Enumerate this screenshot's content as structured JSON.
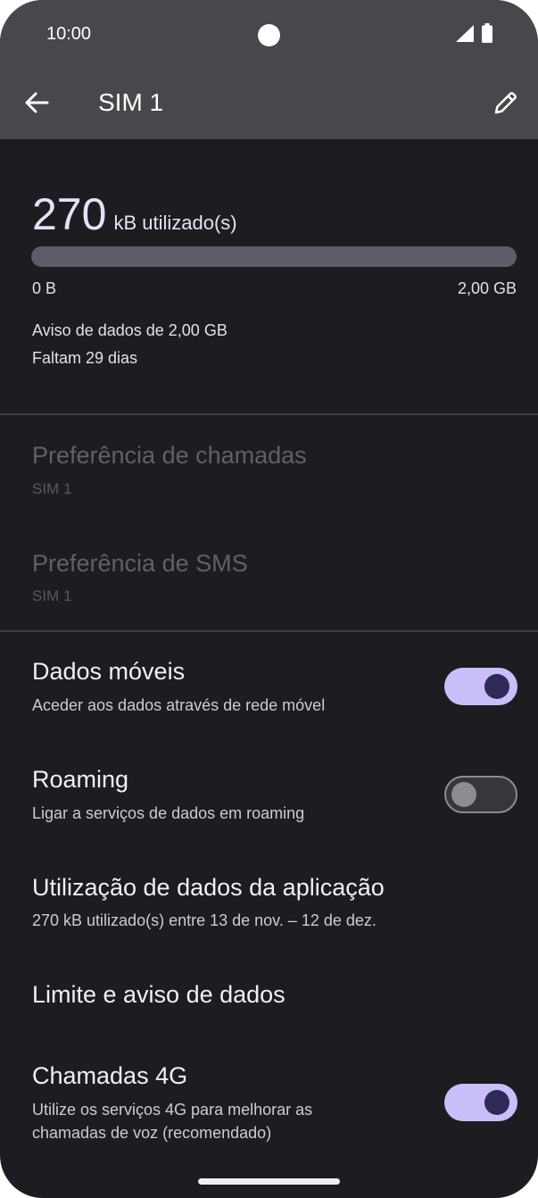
{
  "status_bar": {
    "time": "10:00",
    "icons": [
      "camera-cutout",
      "signal-icon",
      "battery-icon"
    ]
  },
  "app_bar": {
    "back_icon": "arrow-left",
    "title": "SIM 1",
    "edit_icon": "pencil"
  },
  "usage": {
    "amount": "270",
    "unit": "kB utilizado(s)",
    "progress_fraction": 0.0,
    "range_min": "0 B",
    "range_max": "2,00 GB",
    "warning": "Aviso de dados de 2,00 GB",
    "days_left": "Faltam 29 dias"
  },
  "preferences": [
    {
      "title": "Preferência de chamadas",
      "value": "SIM 1",
      "enabled": false
    },
    {
      "title": "Preferência de SMS",
      "value": "SIM 1",
      "enabled": false
    }
  ],
  "settings": {
    "mobile_data": {
      "title": "Dados móveis",
      "summary": "Aceder aos dados através de rede móvel",
      "checked": true
    },
    "roaming": {
      "title": "Roaming",
      "summary": "Ligar a serviços de dados em roaming",
      "checked": false
    },
    "app_data_usage": {
      "title": "Utilização de dados da aplicação",
      "summary": "270 kB utilizado(s) entre 13 de nov. – 12 de dez."
    },
    "data_limit": {
      "title": "Limite e aviso de dados"
    },
    "calls_4g": {
      "title": "Chamadas 4G",
      "summary_line1": "Utilize os serviços 4G para melhorar as",
      "summary_line2": "chamadas de voz (recomendado)",
      "checked": true
    }
  },
  "colors": {
    "app_bar_bg": "#48474c",
    "screen_bg": "#1d1c21",
    "toggle_on_track": "#c9bef7",
    "toggle_on_knob": "#2f2a58",
    "progress_track": "#5e5c68"
  }
}
